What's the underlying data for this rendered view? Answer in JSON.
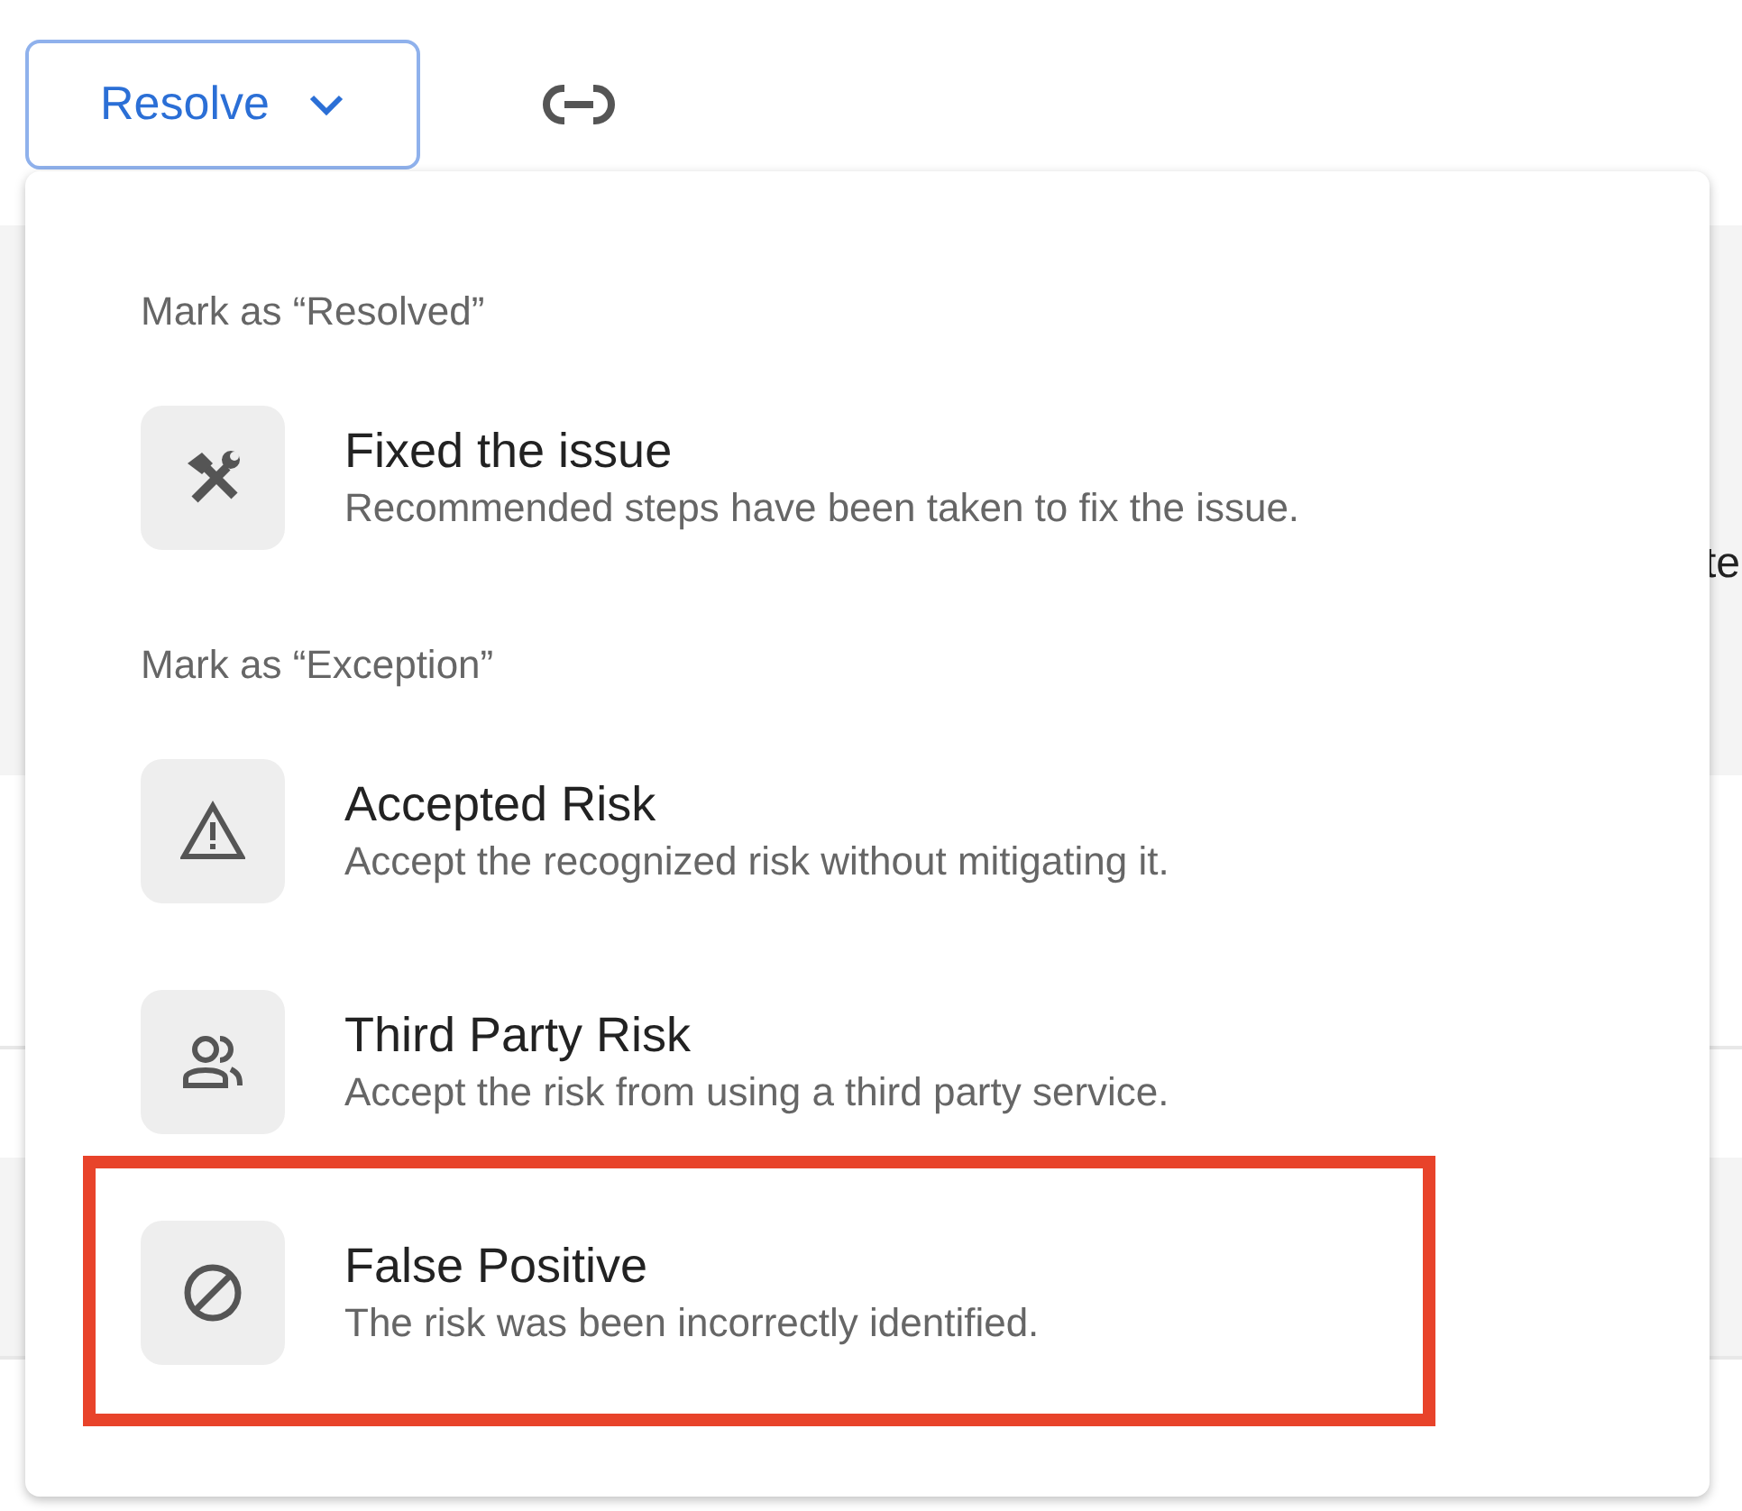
{
  "resolve_button": {
    "label": "Resolve"
  },
  "sections": [
    {
      "heading": "Mark as “Resolved”",
      "items": [
        {
          "kind": "tools",
          "title": "Fixed the issue",
          "description": "Recommended steps have been taken to fix the issue.",
          "highlighted": false
        }
      ]
    },
    {
      "heading": "Mark as “Exception”",
      "items": [
        {
          "kind": "warning",
          "title": "Accepted Risk",
          "description": "Accept the recognized risk without mitigating it.",
          "highlighted": false
        },
        {
          "kind": "people",
          "title": "Third Party Risk",
          "description": "Accept the risk from using a third party service.",
          "highlighted": false
        },
        {
          "kind": "ban",
          "title": "False Positive",
          "description": "The risk was been incorrectly identified.",
          "highlighted": true
        }
      ]
    }
  ],
  "background_text": "te"
}
